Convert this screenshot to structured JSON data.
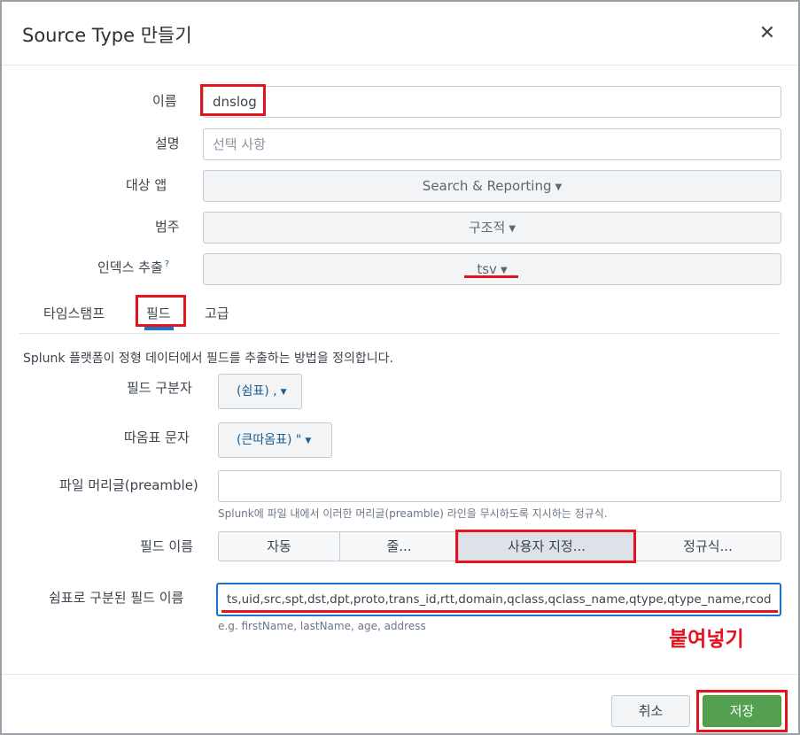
{
  "dialog": {
    "title": "Source Type 만들기",
    "close_icon": "close-icon"
  },
  "form": {
    "name_label": "이름",
    "name_value": "dnslog",
    "description_label": "설명",
    "description_placeholder": "선택 사항",
    "app_label": "대상 앱",
    "app_value": "Search & Reporting",
    "category_label": "범주",
    "category_value": "구조적",
    "indexed_extraction_label": "인덱스 추출",
    "indexed_extraction_help": "?",
    "indexed_extraction_value": "tsv"
  },
  "tabs": [
    {
      "label": "타임스탬프"
    },
    {
      "label": "필드"
    },
    {
      "label": "고급"
    }
  ],
  "fields_tab": {
    "description": "Splunk 플랫폼이 정형 데이터에서 필드를 추출하는 방법을 정의합니다.",
    "delimiter_label": "필드 구분자",
    "delimiter_value": "(쉼표) ,",
    "quote_label": "따옴표 문자",
    "quote_value": "(큰따옴표) \"",
    "preamble_label": "파일 머리글(preamble)",
    "preamble_value": "",
    "preamble_help": "Splunk에 파일 내에서 이러한 머리글(preamble) 라인을 무시하도록 지시하는 정규식.",
    "field_names_label": "필드 이름",
    "field_name_modes": [
      {
        "label": "자동"
      },
      {
        "label": "줄..."
      },
      {
        "label": "사용자 지정..."
      },
      {
        "label": "정규식..."
      }
    ],
    "comma_fields_label": "쉼표로 구분된 필드 이름",
    "comma_fields_value": "ts,uid,src,spt,dst,dpt,proto,trans_id,rtt,domain,qclass,qclass_name,qtype,qtype_name,rcod",
    "comma_fields_help": "e.g. firstName, lastName, age, address"
  },
  "annotation": "붙여넣기",
  "footer": {
    "cancel_label": "취소",
    "save_label": "저장"
  },
  "colors": {
    "accent_blue": "#1a73c7",
    "highlight_red": "#e3141e",
    "save_green": "#53a051"
  }
}
